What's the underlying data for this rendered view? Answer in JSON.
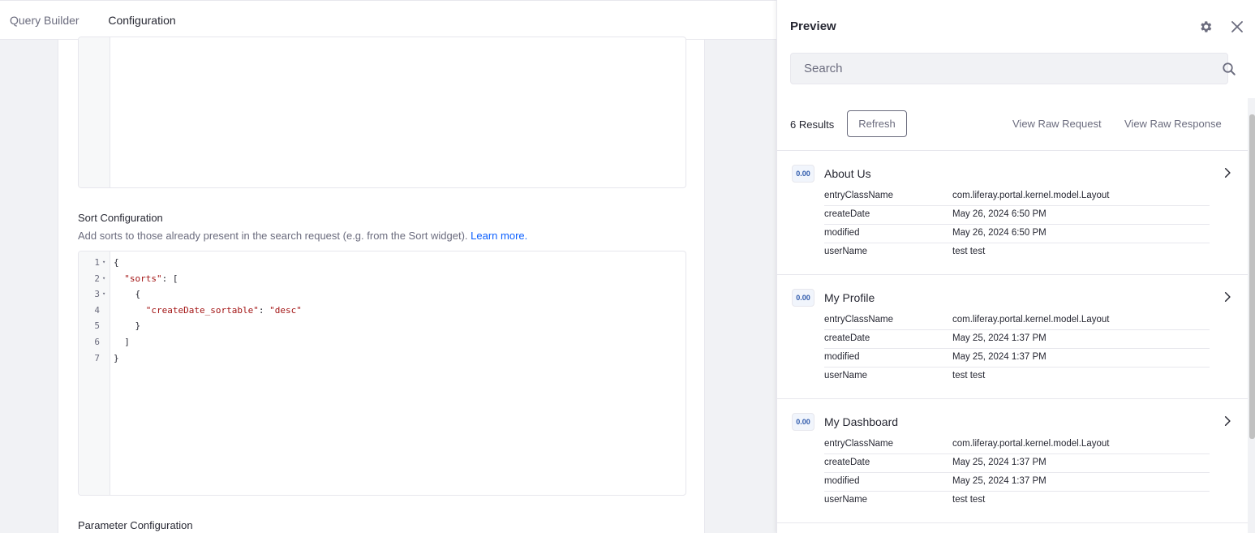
{
  "tabs": {
    "query_builder": "Query Builder",
    "configuration": "Configuration"
  },
  "sort_config": {
    "title": "Sort Configuration",
    "description": "Add sorts to those already present in the search request (e.g. from the Sort widget).",
    "learn_more": "Learn more.",
    "code": [
      {
        "n": "1",
        "fold": true,
        "text": "{"
      },
      {
        "n": "2",
        "fold": true,
        "text": "  \"sorts\": ["
      },
      {
        "n": "3",
        "fold": true,
        "text": "    {"
      },
      {
        "n": "4",
        "fold": false,
        "text": "      \"createDate_sortable\": \"desc\""
      },
      {
        "n": "5",
        "fold": false,
        "text": "    }"
      },
      {
        "n": "6",
        "fold": false,
        "text": "  ]"
      },
      {
        "n": "7",
        "fold": false,
        "text": "}"
      }
    ]
  },
  "parameter_config": {
    "title": "Parameter Configuration"
  },
  "preview": {
    "title": "Preview",
    "search_placeholder": "Search",
    "results_count": "6 Results",
    "refresh": "Refresh",
    "view_raw_request": "View Raw Request",
    "view_raw_response": "View Raw Response",
    "results": [
      {
        "score": "0.00",
        "title": "About Us",
        "fields": [
          {
            "key": "entryClassName",
            "value": "com.liferay.portal.kernel.model.Layout"
          },
          {
            "key": "createDate",
            "value": "May 26, 2024 6:50 PM"
          },
          {
            "key": "modified",
            "value": "May 26, 2024 6:50 PM"
          },
          {
            "key": "userName",
            "value": "test test"
          }
        ]
      },
      {
        "score": "0.00",
        "title": "My Profile",
        "fields": [
          {
            "key": "entryClassName",
            "value": "com.liferay.portal.kernel.model.Layout"
          },
          {
            "key": "createDate",
            "value": "May 25, 2024 1:37 PM"
          },
          {
            "key": "modified",
            "value": "May 25, 2024 1:37 PM"
          },
          {
            "key": "userName",
            "value": "test test"
          }
        ]
      },
      {
        "score": "0.00",
        "title": "My Dashboard",
        "fields": [
          {
            "key": "entryClassName",
            "value": "com.liferay.portal.kernel.model.Layout"
          },
          {
            "key": "createDate",
            "value": "May 25, 2024 1:37 PM"
          },
          {
            "key": "modified",
            "value": "May 25, 2024 1:37 PM"
          },
          {
            "key": "userName",
            "value": "test test"
          }
        ]
      }
    ]
  },
  "colors": {
    "accent": "#528eff",
    "link": "#0b5fff",
    "code_string": "#a31515"
  }
}
